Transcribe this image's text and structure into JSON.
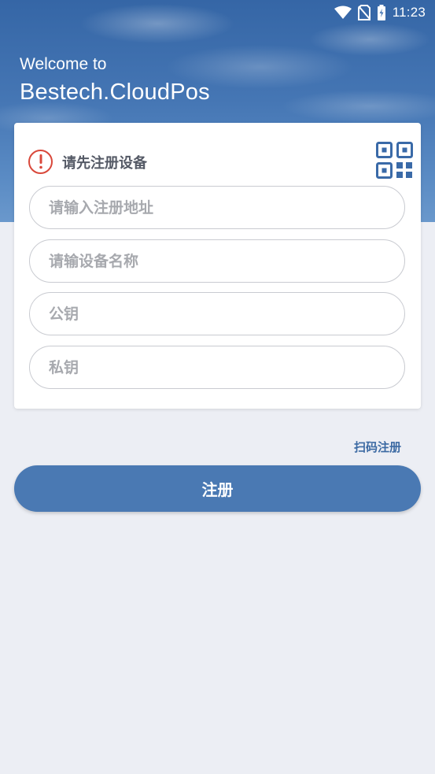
{
  "status_bar": {
    "time": "11:23",
    "icons": [
      "wifi-icon",
      "no-sim-icon",
      "battery-charging-icon"
    ]
  },
  "header": {
    "welcome": "Welcome to",
    "brand": "Bestech.CloudPos"
  },
  "card": {
    "notice_icon": "warning-icon",
    "notice": "请先注册设备",
    "qr_icon": "qr-code-icon",
    "fields": {
      "address": {
        "placeholder": "请输入注册地址",
        "value": ""
      },
      "device_name": {
        "placeholder": "请输设备名称",
        "value": ""
      },
      "public_key": {
        "placeholder": "公钥",
        "value": ""
      },
      "private_key": {
        "placeholder": "私钥",
        "value": ""
      }
    }
  },
  "scan_register_label": "扫码注册",
  "register_button_label": "注册",
  "colors": {
    "primary": "#4a79b3",
    "link": "#3c6aa3",
    "warning": "#d9483b",
    "background": "#eceef4"
  }
}
